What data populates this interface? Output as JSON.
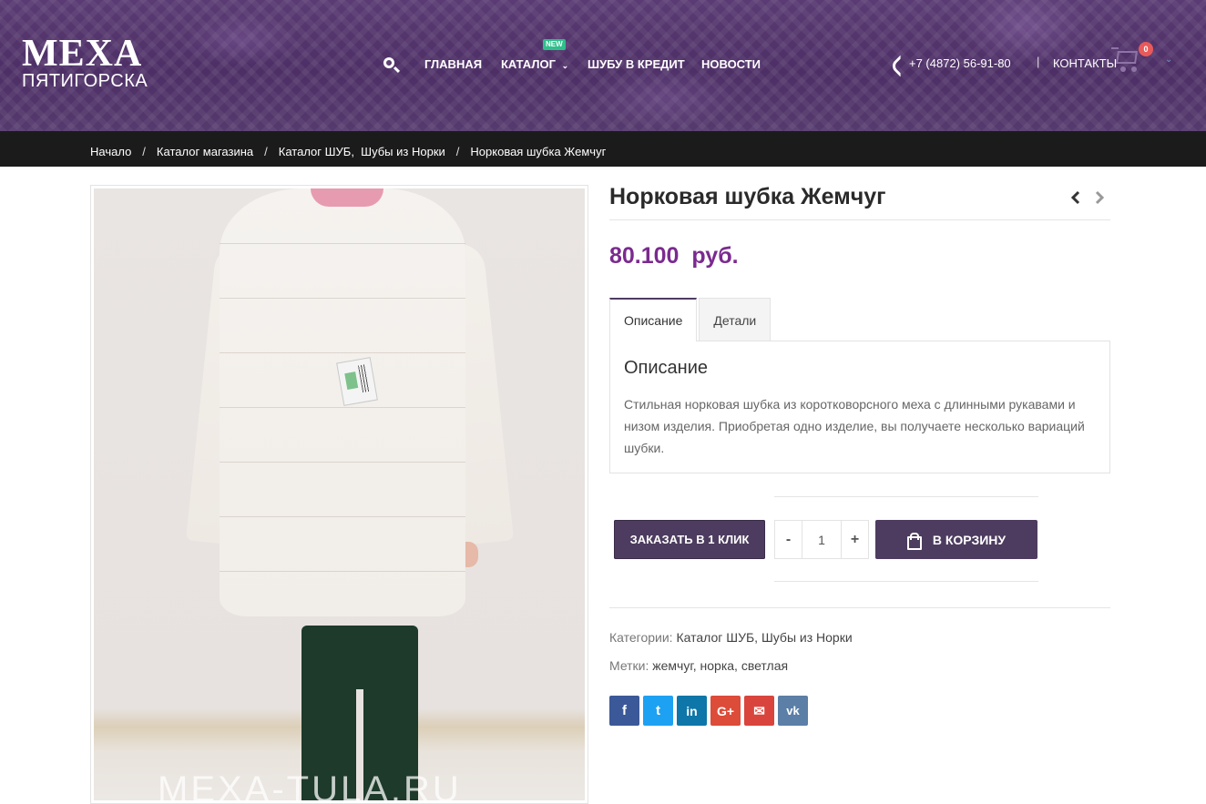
{
  "logo": {
    "top": "МЕХА",
    "bottom": "ПЯТИГОРСКА"
  },
  "nav": {
    "items": [
      {
        "label": "ГЛАВНАЯ"
      },
      {
        "label": "КАТАЛОГ"
      },
      {
        "label": "ШУБУ В КРЕДИТ"
      },
      {
        "label": "НОВОСТИ"
      }
    ],
    "catalog_badge": "NEW"
  },
  "header": {
    "phone": "+7 (4872) 56-91-80",
    "separator": "|",
    "contacts": "КОНТАКТЫ",
    "cart_count": "0"
  },
  "breadcrumb": [
    "Начало",
    "Каталог магазина",
    "Каталог ШУБ,  Шубы из Норки",
    "Норковая шубка Жемчуг"
  ],
  "product": {
    "title": "Норковая шубка Жемчуг",
    "price": "80.100  руб.",
    "image_watermark": "MEXA-TULA.RU",
    "tabs": [
      "Описание",
      "Детали"
    ],
    "active_tab": "Описание",
    "description_title": "Описание",
    "description_text": "Стильная норковая шубка из коротковорсного меха с длинными рукавами и низом изделия. Приобретая одно изделие, вы получаете несколько вариаций шубки."
  },
  "actions": {
    "order_one_click": "ЗАКАЗАТЬ В 1 КЛИК",
    "qty_minus": "-",
    "qty_value": "1",
    "qty_plus": "+",
    "add_to_cart": "В КОРЗИНУ"
  },
  "meta": {
    "categories_label": "Категории:",
    "categories": "Каталог ШУБ, Шубы из Норки",
    "tags_label": "Метки:",
    "tags": "жемчуг, норка, светлая"
  },
  "social": [
    {
      "icon": "facebook-icon",
      "glyph": "f",
      "color": "#3b5998"
    },
    {
      "icon": "twitter-icon",
      "glyph": "t",
      "color": "#1da1f2"
    },
    {
      "icon": "linkedin-icon",
      "glyph": "in",
      "color": "#0e76a8"
    },
    {
      "icon": "google-plus-icon",
      "glyph": "G+",
      "color": "#dd4b39"
    },
    {
      "icon": "email-icon",
      "glyph": "✉",
      "color": "#d9453d"
    },
    {
      "icon": "vk-icon",
      "glyph": "vk",
      "color": "#5b7fa6"
    }
  ],
  "colors": {
    "accent": "#4d3c5f",
    "price": "#7b2a8f",
    "badge": "#2ebf8b",
    "cart_count": "#e85a5a"
  }
}
